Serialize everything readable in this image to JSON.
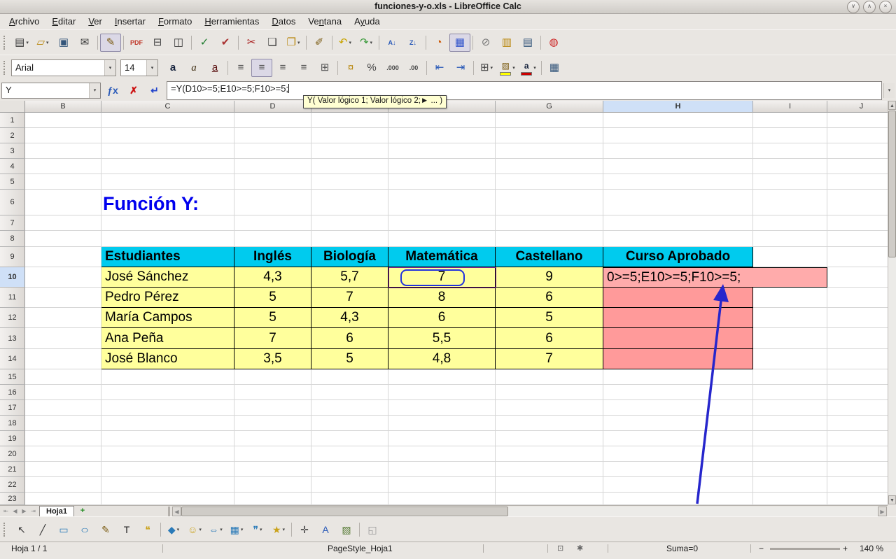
{
  "titlebar": {
    "title": "funciones-y-o.xls - LibreOffice Calc",
    "buttons": [
      {
        "name": "minimize",
        "glyph": "∨"
      },
      {
        "name": "maximize",
        "glyph": "∧"
      },
      {
        "name": "close",
        "glyph": "×"
      }
    ]
  },
  "menubar": {
    "items": [
      {
        "label": "Archivo",
        "u": 0
      },
      {
        "label": "Editar",
        "u": 0
      },
      {
        "label": "Ver",
        "u": 0
      },
      {
        "label": "Insertar",
        "u": 0
      },
      {
        "label": "Formato",
        "u": 0
      },
      {
        "label": "Herramientas",
        "u": 0
      },
      {
        "label": "Datos",
        "u": 0
      },
      {
        "label": "Ventana",
        "u": 2
      },
      {
        "label": "Ayuda",
        "u": 1
      }
    ]
  },
  "toolbar_standard": {
    "icons": [
      {
        "grip": true
      },
      {
        "name": "new-document",
        "glyph": "▤",
        "dropdown": true
      },
      {
        "name": "open",
        "glyph": "▱",
        "dropdown": true,
        "color": "#b8860b"
      },
      {
        "name": "save",
        "glyph": "▣",
        "color": "#33557a"
      },
      {
        "name": "email",
        "glyph": "✉"
      },
      {
        "sep": true
      },
      {
        "name": "edit-mode",
        "glyph": "✎",
        "active": true,
        "color": "#7a5a10"
      },
      {
        "sep": true
      },
      {
        "name": "export-pdf",
        "glyph": "PDF",
        "small": true,
        "color": "#c0392b"
      },
      {
        "name": "print",
        "glyph": "⊟",
        "color": "#444"
      },
      {
        "name": "print-preview",
        "glyph": "◫"
      },
      {
        "sep": true
      },
      {
        "name": "spelling",
        "glyph": "✓",
        "color": "#1a7a2a"
      },
      {
        "name": "auto-spellcheck",
        "glyph": "✔",
        "color": "#aa3333"
      },
      {
        "sep": true
      },
      {
        "name": "cut",
        "glyph": "✂",
        "color": "#aa2222"
      },
      {
        "name": "copy",
        "glyph": "❏"
      },
      {
        "name": "paste",
        "glyph": "❐",
        "dropdown": true,
        "color": "#b8860b"
      },
      {
        "sep": true
      },
      {
        "name": "clone-formatting",
        "glyph": "✐",
        "color": "#7a5a10"
      },
      {
        "sep": true
      },
      {
        "name": "undo",
        "glyph": "↶",
        "dropdown": true,
        "color": "#c8a400"
      },
      {
        "name": "redo",
        "glyph": "↷",
        "dropdown": true,
        "color": "#3a9a3a"
      },
      {
        "sep": true
      },
      {
        "name": "sort-ascending",
        "glyph": "A↓",
        "small": true,
        "color": "#2a5ab8"
      },
      {
        "name": "sort-descending",
        "glyph": "Z↓",
        "small": true,
        "color": "#2a5ab8"
      },
      {
        "sep": true
      },
      {
        "name": "insert-chart",
        "glyph": "◔",
        "color": "#cc5500"
      },
      {
        "name": "navigator",
        "glyph": "▦",
        "color": "#3355cc",
        "active": true
      },
      {
        "sep": true
      },
      {
        "name": "hyperlink",
        "glyph": "⊘",
        "color": "#777"
      },
      {
        "name": "gallery",
        "glyph": "▥",
        "color": "#b8860b"
      },
      {
        "name": "data-sources",
        "glyph": "▤",
        "color": "#33557a"
      },
      {
        "sep": true
      },
      {
        "name": "help",
        "glyph": "◍",
        "color": "#cc2222"
      }
    ]
  },
  "toolbar_formatting": {
    "font_name": "Arial",
    "font_size": "14",
    "icons": [
      {
        "name": "bold",
        "glyph": "a",
        "cls": "fmt-bold"
      },
      {
        "name": "italic",
        "glyph": "a",
        "cls": "fmt-italic"
      },
      {
        "name": "underline",
        "glyph": "a",
        "cls": "fmt-underline"
      },
      {
        "sep": true
      },
      {
        "name": "align-left",
        "glyph": "≡",
        "color": "#555"
      },
      {
        "name": "align-center",
        "glyph": "≡",
        "active": true,
        "color": "#555"
      },
      {
        "name": "align-right",
        "glyph": "≡",
        "color": "#555"
      },
      {
        "name": "justify",
        "glyph": "≡",
        "color": "#555"
      },
      {
        "name": "merge-cells",
        "glyph": "⊞",
        "color": "#555"
      },
      {
        "sep": true
      },
      {
        "name": "currency-format",
        "glyph": "¤",
        "color": "#b8860b"
      },
      {
        "name": "percent-format",
        "glyph": "%",
        "color": "#444"
      },
      {
        "name": "add-decimal-place",
        "glyph": ".000",
        "small": true,
        "color": "#444"
      },
      {
        "name": "delete-decimal-place",
        "glyph": ".00",
        "small": true,
        "color": "#444"
      },
      {
        "sep": true
      },
      {
        "name": "decrease-indent",
        "glyph": "⇤",
        "color": "#2a5ab8"
      },
      {
        "name": "increase-indent",
        "glyph": "⇥",
        "color": "#2a5ab8"
      },
      {
        "sep": true
      },
      {
        "name": "borders",
        "glyph": "⊞",
        "dropdown": true,
        "color": "#444"
      },
      {
        "name": "background-color",
        "glyph": "▨",
        "colorbar": "#ffff00",
        "dropdown": true,
        "color": "#7a5a10"
      },
      {
        "name": "font-color",
        "glyph": "a",
        "colorbar": "#cc0000",
        "dropdown": true,
        "cls": "fmt-bold"
      },
      {
        "sep": true
      },
      {
        "name": "cell-grid",
        "glyph": "▦",
        "color": "#33557a"
      }
    ]
  },
  "formula_bar": {
    "name_box": "Y",
    "formula": "=Y(D10>=5;E10>=5;F10>=5;",
    "buttons": [
      {
        "name": "function-wizard",
        "glyph": "ƒx",
        "color": "#2a5ab8"
      },
      {
        "name": "cancel",
        "glyph": "✗",
        "color": "#cc1111"
      },
      {
        "name": "accept",
        "glyph": "↵",
        "color": "#2244cc"
      }
    ]
  },
  "tooltip": {
    "text": "Y( Valor lógico 1; Valor lógico 2;► ... )"
  },
  "ui": {
    "dd_glyph": "▾"
  },
  "scrollbars": {
    "up": "▲",
    "down": "▼",
    "left": "◀",
    "right": "▶"
  },
  "grid": {
    "columns": [
      "B",
      "C",
      "D",
      "E",
      "F",
      "G",
      "H",
      "I",
      "J"
    ],
    "active_column": "H",
    "rows": [
      "1",
      "2",
      "3",
      "4",
      "5",
      "6",
      "7",
      "8",
      "9",
      "10",
      "11",
      "12",
      "13",
      "14",
      "15",
      "16",
      "17",
      "18",
      "19",
      "20",
      "21",
      "22",
      "23"
    ],
    "active_row": "10",
    "title_text": "Función Y:",
    "table": {
      "headers": [
        "Estudiantes",
        "Inglés",
        "Biología",
        "Matemática",
        "Castellano",
        "Curso Aprobado"
      ],
      "data": [
        [
          "José Sánchez",
          "4,3",
          "5,7",
          "7",
          "9"
        ],
        [
          "Pedro Pérez",
          "5",
          "7",
          "8",
          "6"
        ],
        [
          "María Campos",
          "5",
          "4,3",
          "6",
          "5"
        ],
        [
          "Ana Peña",
          "7",
          "6",
          "5,5",
          "6"
        ],
        [
          "José Blanco",
          "3,5",
          "5",
          "4,8",
          "7"
        ]
      ],
      "editing_cell_text": "0>=5;E10>=5;F10>=5;"
    }
  },
  "toolbar_drawing": {
    "icons": [
      {
        "grip": true
      },
      {
        "name": "select",
        "glyph": "↖",
        "color": "#333"
      },
      {
        "name": "line",
        "glyph": "╱",
        "color": "#333"
      },
      {
        "name": "rectangle",
        "glyph": "▭",
        "color": "#2a7ab8"
      },
      {
        "name": "ellipse",
        "glyph": "○",
        "cls": "wide",
        "color": "#2a7ab8"
      },
      {
        "name": "freeform-line",
        "glyph": "✎",
        "color": "#7a5a10"
      },
      {
        "name": "insert-text-box",
        "glyph": "T",
        "color": "#222"
      },
      {
        "name": "callout",
        "glyph": "❝",
        "color": "#caa21a"
      },
      {
        "sep": true
      },
      {
        "name": "basic-shapes",
        "glyph": "◆",
        "dropdown": true,
        "color": "#2a7ab8"
      },
      {
        "name": "symbol-shapes",
        "glyph": "☺",
        "dropdown": true,
        "color": "#caa21a"
      },
      {
        "name": "block-arrows",
        "glyph": "⇔",
        "dropdown": true,
        "color": "#2a7ab8"
      },
      {
        "name": "flowchart",
        "glyph": "▦",
        "dropdown": true,
        "color": "#2a7ab8"
      },
      {
        "name": "callout-shapes",
        "glyph": "❞",
        "dropdown": true,
        "color": "#2a7ab8"
      },
      {
        "name": "stars-shapes",
        "glyph": "★",
        "dropdown": true,
        "color": "#caa21a"
      },
      {
        "sep": true
      },
      {
        "name": "edit-points",
        "glyph": "✛",
        "color": "#444"
      },
      {
        "name": "fontwork",
        "glyph": "A",
        "color": "#2a5ab8"
      },
      {
        "name": "insert-image",
        "glyph": "▧",
        "color": "#557a33"
      },
      {
        "sep": true
      },
      {
        "name": "extrusion",
        "glyph": "◱",
        "color": "#999"
      }
    ]
  },
  "sheet_tabs": {
    "nav": [
      {
        "name": "first-sheet",
        "glyph": "⇤"
      },
      {
        "name": "previous-sheet",
        "glyph": "◀"
      },
      {
        "name": "next-sheet",
        "glyph": "▶"
      },
      {
        "name": "last-sheet",
        "glyph": "⇥"
      }
    ],
    "tabs": [
      "Hoja1"
    ],
    "add_glyph": "+"
  },
  "statusbar": {
    "sheet_info": "Hoja 1 / 1",
    "page_style": "PageStyle_Hoja1",
    "sum": "Suma=0",
    "zoom": "140 %",
    "zoom_minus": "−",
    "zoom_plus": "+",
    "icons": [
      {
        "name": "selection-mode",
        "glyph": "⊡"
      },
      {
        "name": "document-modified",
        "glyph": "✱"
      }
    ]
  },
  "colors": {
    "table_header": "#00cbee",
    "cell_yellow": "#ffff9c",
    "cell_pink": "#ff9a9a",
    "title_blue": "#0000ee",
    "arrow_blue": "#2626cc"
  }
}
